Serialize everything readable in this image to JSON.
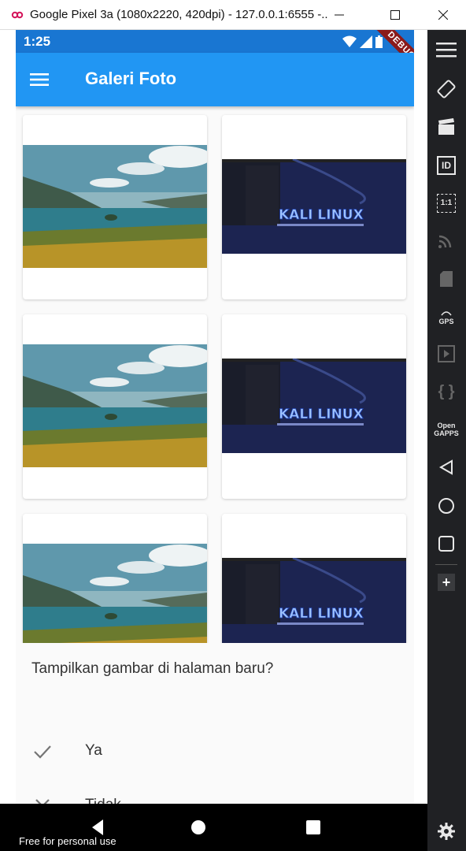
{
  "window": {
    "title": "Google Pixel 3a (1080x2220, 420dpi) - 127.0.0.1:6555 -..."
  },
  "statusbar": {
    "time": "1:25",
    "debug_label": "DEBUG"
  },
  "appbar": {
    "title": "Galeri Foto",
    "menu_icon": "hamburger-menu-icon"
  },
  "gallery": {
    "items": [
      {
        "image": "lake-landscape"
      },
      {
        "image": "kali-linux-desktop",
        "text": "KALI LINUX"
      },
      {
        "image": "lake-landscape"
      },
      {
        "image": "kali-linux-desktop",
        "text": "KALI LINUX"
      },
      {
        "image": "lake-landscape"
      },
      {
        "image": "kali-linux-desktop",
        "text": "KALI LINUX"
      }
    ]
  },
  "dialog": {
    "question": "Tampilkan gambar di halaman baru?",
    "options": [
      {
        "label": "Ya",
        "icon": "check-icon"
      },
      {
        "label": "Tidak",
        "icon": "close-icon"
      }
    ]
  },
  "sidepanel": {
    "gps_label": "GPS",
    "opengapps_label": "Open GAPPS",
    "ratio_label": "1:1",
    "id_label": "ID"
  },
  "footer": {
    "watermark": "Free for personal use"
  },
  "colors": {
    "appbar": "#2196f3",
    "statusbar": "#1976d2",
    "panel": "#202124"
  }
}
